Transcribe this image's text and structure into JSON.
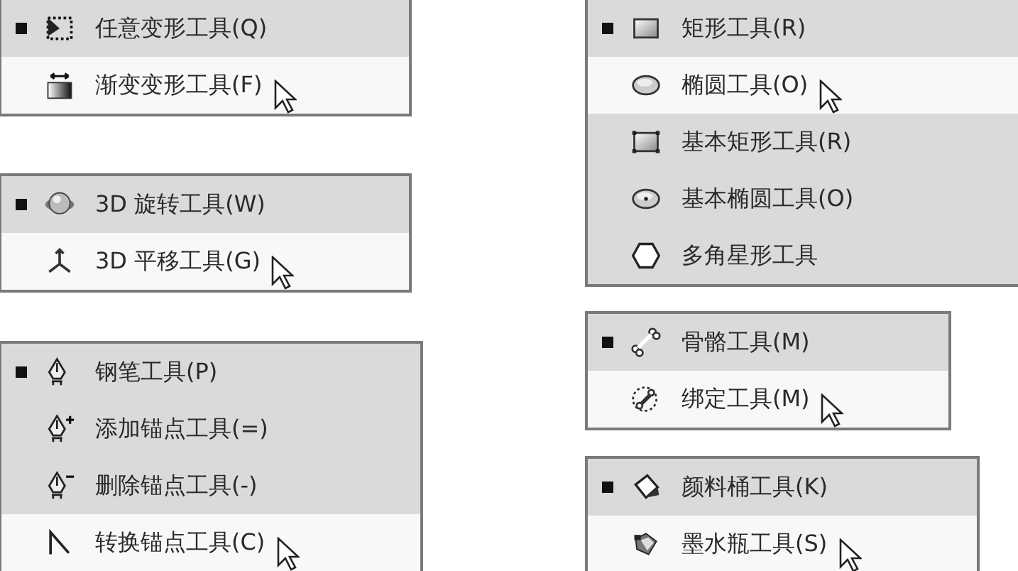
{
  "columns": [
    {
      "menus": [
        {
          "items": [
            {
              "label": "任意变形工具(Q)",
              "current": true,
              "selected": false
            },
            {
              "label": "渐变变形工具(F)",
              "current": false,
              "selected": true
            }
          ]
        },
        {
          "items": [
            {
              "label": "3D 旋转工具(W)",
              "current": true,
              "selected": false
            },
            {
              "label": "3D 平移工具(G)",
              "current": false,
              "selected": true
            }
          ]
        },
        {
          "items": [
            {
              "label": "钢笔工具(P)",
              "current": true,
              "selected": false
            },
            {
              "label": "添加锚点工具(=)",
              "current": false,
              "selected": false
            },
            {
              "label": "删除锚点工具(-)",
              "current": false,
              "selected": false
            },
            {
              "label": "转换锚点工具(C)",
              "current": false,
              "selected": true
            }
          ]
        }
      ]
    },
    {
      "menus": [
        {
          "items": [
            {
              "label": "矩形工具(R)",
              "current": true,
              "selected": false
            },
            {
              "label": "椭圆工具(O)",
              "current": false,
              "selected": true
            },
            {
              "label": "基本矩形工具(R)",
              "current": false,
              "selected": false
            },
            {
              "label": "基本椭圆工具(O)",
              "current": false,
              "selected": false
            },
            {
              "label": "多角星形工具",
              "current": false,
              "selected": false
            }
          ]
        },
        {
          "items": [
            {
              "label": "骨骼工具(M)",
              "current": true,
              "selected": false
            },
            {
              "label": "绑定工具(M)",
              "current": false,
              "selected": true
            }
          ]
        },
        {
          "items": [
            {
              "label": "颜料桶工具(K)",
              "current": true,
              "selected": false
            },
            {
              "label": "墨水瓶工具(S)",
              "current": false,
              "selected": true
            }
          ]
        }
      ]
    }
  ]
}
